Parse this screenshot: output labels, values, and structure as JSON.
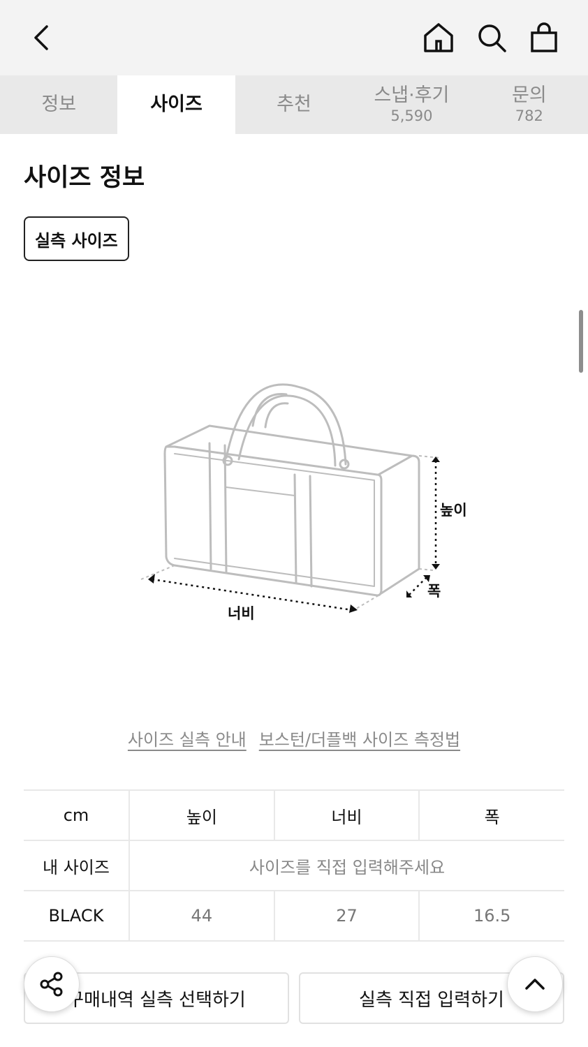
{
  "tabs": [
    {
      "label": "정보",
      "count": ""
    },
    {
      "label": "사이즈",
      "count": ""
    },
    {
      "label": "추천",
      "count": ""
    },
    {
      "label": "스냅·후기",
      "count": "5,590"
    },
    {
      "label": "문의",
      "count": "782"
    }
  ],
  "active_tab": "사이즈",
  "section": {
    "title": "사이즈 정보",
    "chip_label": "실측 사이즈"
  },
  "diagram": {
    "height_label": "높이",
    "width_label": "너비",
    "depth_label": "폭"
  },
  "links": {
    "guide": "사이즈 실측 안내",
    "method": "보스턴/더플백 사이즈 측정법"
  },
  "table": {
    "headers": [
      "cm",
      "높이",
      "너비",
      "폭"
    ],
    "my_size_label": "내 사이즈",
    "my_size_placeholder": "사이즈를 직접 입력해주세요",
    "rows": [
      {
        "name": "BLACK",
        "values": [
          "44",
          "27",
          "16.5"
        ]
      }
    ]
  },
  "buttons": {
    "purchase": "구매내역 실측 선택하기",
    "manual": "실측 직접 입력하기"
  },
  "icons": {
    "back": "chevron-left-icon",
    "home": "home-icon",
    "search": "search-icon",
    "cart": "shopping-bag-icon",
    "share": "share-icon",
    "top": "chevron-up-icon"
  }
}
